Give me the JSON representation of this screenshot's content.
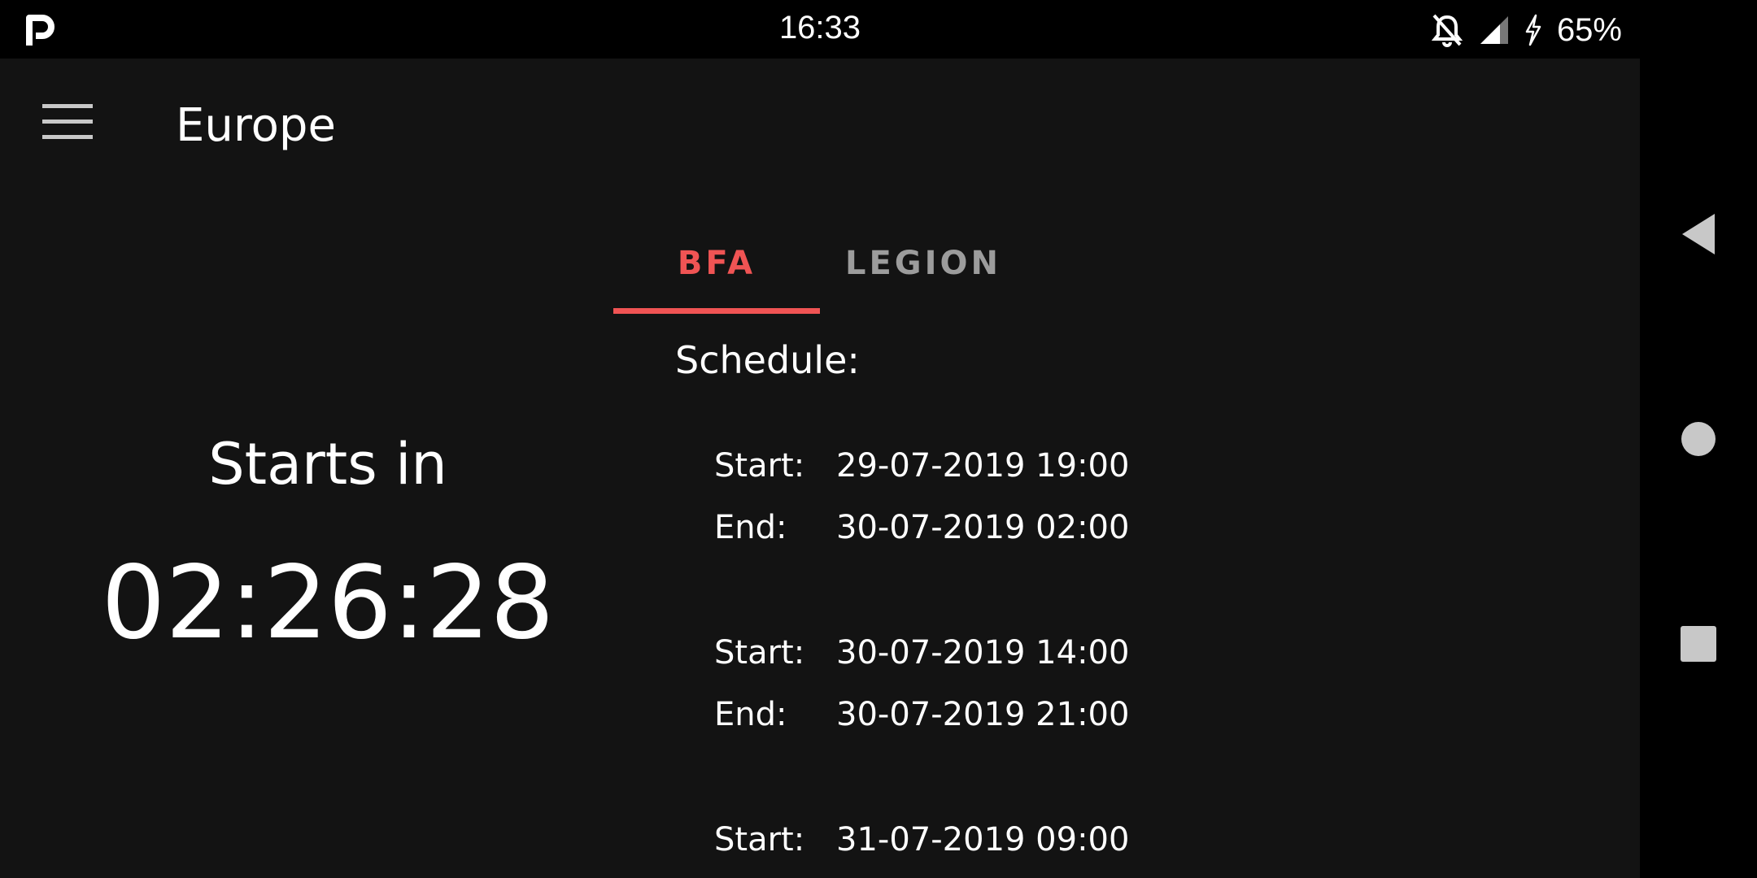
{
  "status_bar": {
    "time": "16:33",
    "battery": "65%",
    "icons": [
      "parking-app-icon",
      "bell-off-icon",
      "signal-icon",
      "charging-icon"
    ]
  },
  "app_bar": {
    "title": "Europe",
    "menu_icon": "menu-icon"
  },
  "tabs": [
    {
      "label": "BFA",
      "active": true
    },
    {
      "label": "LEGION",
      "active": false
    }
  ],
  "countdown": {
    "label": "Starts in",
    "value": "02:26:28"
  },
  "schedule": {
    "heading": "Schedule:",
    "start_label": "Start:",
    "end_label": "End:",
    "entries": [
      {
        "start": "29-07-2019 19:00",
        "end": "30-07-2019 02:00"
      },
      {
        "start": "30-07-2019 14:00",
        "end": "30-07-2019 21:00"
      },
      {
        "start": "31-07-2019 09:00"
      }
    ]
  },
  "colors": {
    "background": "#131313",
    "accent": "#f05454",
    "inactive_tab": "#9c9c9c"
  },
  "nav_bar": {
    "icons": [
      "back-icon",
      "home-icon",
      "recents-icon"
    ]
  }
}
